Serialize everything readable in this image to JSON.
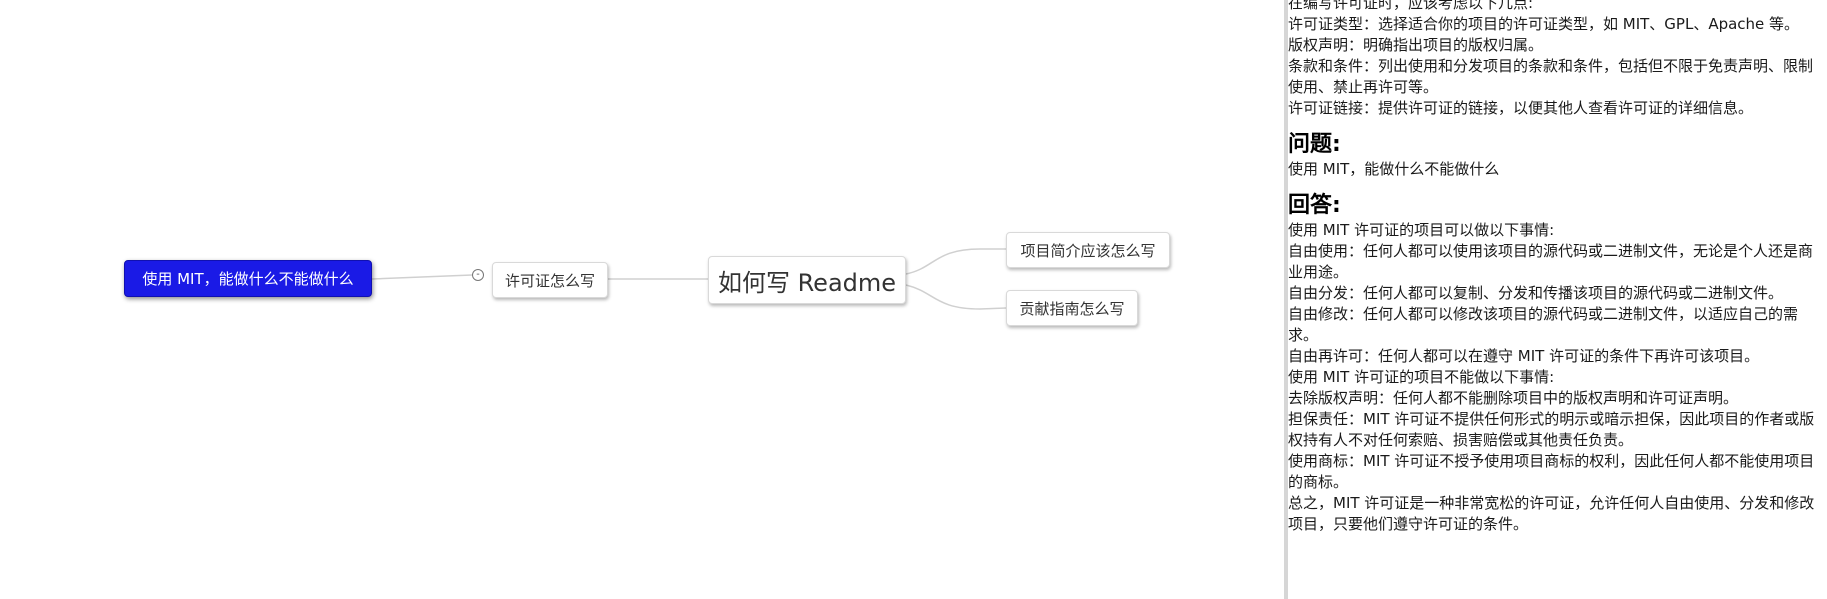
{
  "mindmap": {
    "root": {
      "label": "如何写 Readme"
    },
    "selected_node": {
      "label": "使用 MIT，能做什么不能做什么"
    },
    "left_child": {
      "label": "许可证怎么写"
    },
    "right_children": [
      {
        "label": "项目简介应该怎么写"
      },
      {
        "label": "贡献指南怎么写"
      }
    ],
    "collapse_glyph": "-",
    "colors": {
      "selected_fill": "#1a1ae6",
      "edge": "#d0d0d0"
    }
  },
  "notes": {
    "intro_lines": [
      "在编写许可证时，应该考虑以下几点:",
      "许可证类型：选择适合你的项目的许可证类型，如 MIT、GPL、Apache 等。",
      "版权声明：明确指出项目的版权归属。",
      "条款和条件：列出使用和分发项目的条款和条件，包括但不限于免责声明、限制使用、禁止再许可等。",
      "许可证链接：提供许可证的链接，以便其他人查看许可证的详细信息。"
    ],
    "question_heading": "问题:",
    "question_text": "使用 MIT，能做什么不能做什么",
    "answer_heading": "回答:",
    "answer_lines": [
      "使用 MIT 许可证的项目可以做以下事情:",
      "自由使用：任何人都可以使用该项目的源代码或二进制文件，无论是个人还是商业用途。",
      "自由分发：任何人都可以复制、分发和传播该项目的源代码或二进制文件。",
      "自由修改：任何人都可以修改该项目的源代码或二进制文件，以适应自己的需求。",
      "自由再许可：任何人都可以在遵守 MIT 许可证的条件下再许可该项目。",
      "使用 MIT 许可证的项目不能做以下事情:",
      "去除版权声明：任何人都不能删除项目中的版权声明和许可证声明。",
      "担保责任：MIT 许可证不提供任何形式的明示或暗示担保，因此项目的作者或版权持有人不对任何索赔、损害赔偿或其他责任负责。",
      "使用商标：MIT 许可证不授予使用项目商标的权利，因此任何人都不能使用项目的商标。",
      "总之，MIT 许可证是一种非常宽松的许可证，允许任何人自由使用、分发和修改项目，只要他们遵守许可证的条件。"
    ]
  }
}
